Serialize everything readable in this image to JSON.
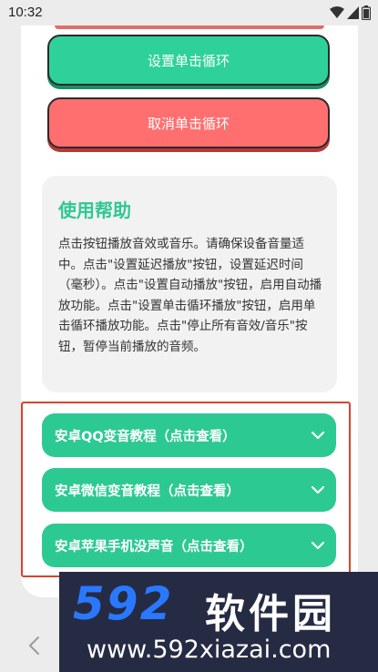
{
  "status": {
    "time": "10:32"
  },
  "buttons": {
    "set_loop": "设置单击循环",
    "cancel_loop": "取消单击循环"
  },
  "help": {
    "title": "使用帮助",
    "body": "点击按钮播放音效或音乐。请确保设备音量适中。点击\"设置延迟播放\"按钮，设置延迟时间（毫秒）。点击\"设置自动播放\"按钮，启用自动播放功能。点击\"设置单击循环播放\"按钮，启用单击循环播放功能。点击\"停止所有音效/音乐\"按钮，暂停当前播放的音频。"
  },
  "accordion": [
    {
      "label": "安卓QQ变音教程（点击查看）"
    },
    {
      "label": "安卓微信变音教程（点击查看）"
    },
    {
      "label": "安卓苹果手机没声音（点击查看）"
    }
  ],
  "watermark": {
    "logo": "592",
    "brand": "软件园",
    "url": "www.592xiazai.com"
  },
  "icons": [
    "wifi-icon",
    "signal-icon",
    "battery-icon",
    "chevron-down-icon",
    "back-arrow-icon"
  ],
  "colors": {
    "green": "#2fd19a",
    "red": "#ff6f6f",
    "accent_title": "#2fc892"
  }
}
